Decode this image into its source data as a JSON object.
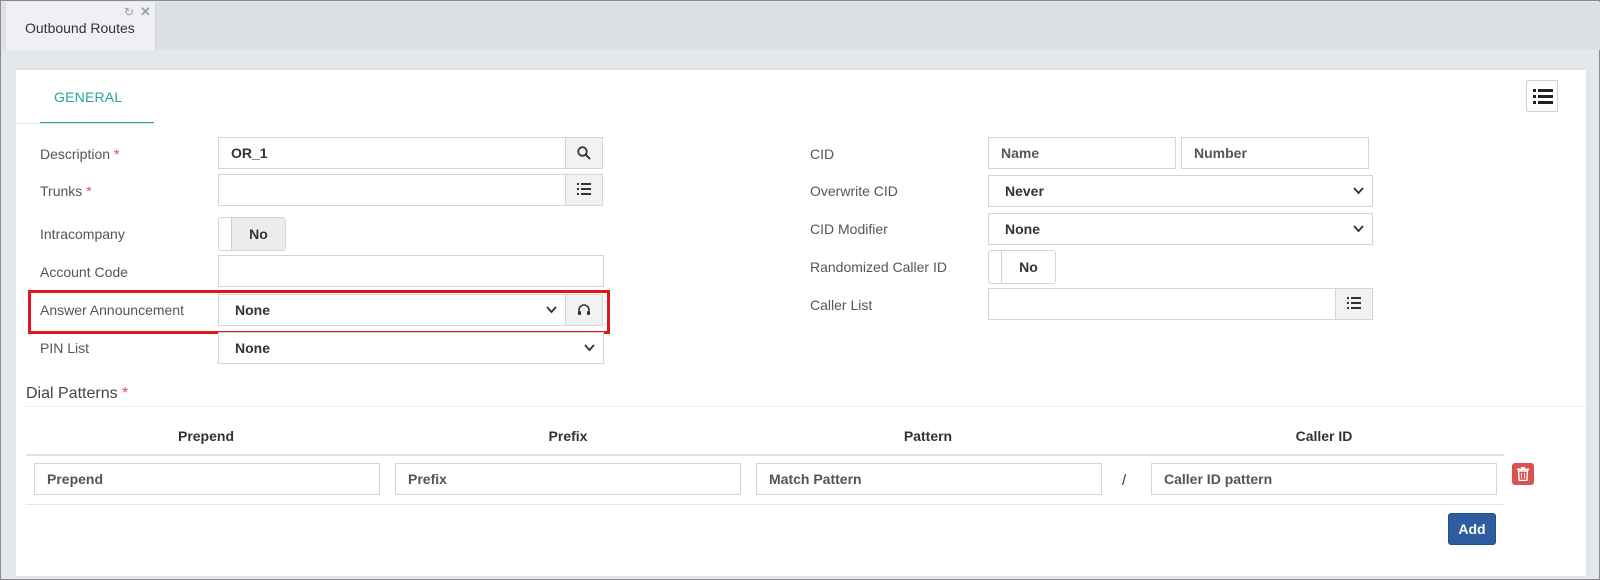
{
  "tabbar": {
    "tab_label": "Outbound Routes",
    "refresh_icon": "refresh-icon",
    "close_icon": "close-icon"
  },
  "section": {
    "tab_label": "GENERAL",
    "menu_icon": "list-icon"
  },
  "left_form": {
    "description": {
      "label": "Description",
      "required": "*",
      "value": "OR_1"
    },
    "trunks": {
      "label": "Trunks",
      "required": "*",
      "value": ""
    },
    "intracompany": {
      "label": "Intracompany",
      "value": "No"
    },
    "account_code": {
      "label": "Account Code",
      "value": ""
    },
    "answer_announcement": {
      "label": "Answer Announcement",
      "value": "None"
    },
    "pin_list": {
      "label": "PIN List",
      "value": "None"
    }
  },
  "right_form": {
    "cid": {
      "label": "CID",
      "name_placeholder": "Name",
      "number_placeholder": "Number"
    },
    "overwrite_cid": {
      "label": "Overwrite CID",
      "value": "Never"
    },
    "cid_modifier": {
      "label": "CID Modifier",
      "value": "None"
    },
    "randomized_caller_id": {
      "label": "Randomized Caller ID",
      "value": "No"
    },
    "caller_list": {
      "label": "Caller List",
      "value": ""
    }
  },
  "dial_patterns": {
    "title": "Dial Patterns",
    "required": "*",
    "headers": [
      "Prepend",
      "Prefix",
      "Pattern",
      "Caller ID"
    ],
    "row": {
      "prepend_placeholder": "Prepend",
      "prefix_placeholder": "Prefix",
      "pattern_placeholder": "Match Pattern",
      "separator": "/",
      "callerid_placeholder": "Caller ID pattern"
    },
    "add_label": "Add"
  },
  "colors": {
    "accent": "#26a69a",
    "highlight": "#e0161d",
    "primary_button": "#2d5d9f",
    "danger": "#d9534f"
  }
}
